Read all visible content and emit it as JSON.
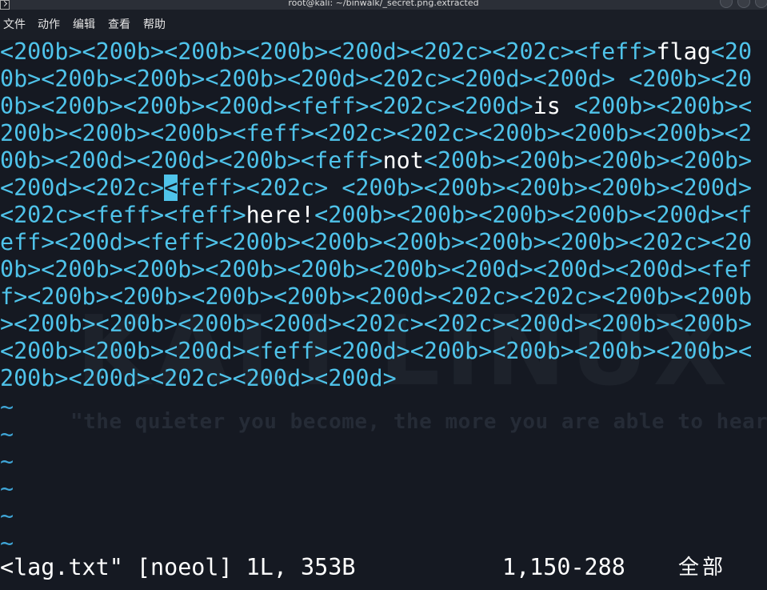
{
  "window": {
    "title": "root@kali: ~/binwalk/_secret.png.extracted"
  },
  "menu": {
    "items": [
      "文件",
      "动作",
      "编辑",
      "查看",
      "帮助"
    ]
  },
  "background": {
    "quote": "\"the quieter you become, the more you are able to hear\"",
    "logo_text": "KALI LINUX"
  },
  "editor": {
    "lines": [
      [
        [
          "tag",
          "<200b><200b><200b><200b><200d><202c><202c><feff>"
        ],
        [
          "text",
          "flag"
        ],
        [
          "tag",
          "<20"
        ]
      ],
      [
        [
          "tag",
          "0b><200b><200b><200b><200d><202c><200d><200d> <200b><20"
        ]
      ],
      [
        [
          "tag",
          "0b><200b><200b><200d><feff><202c><200d>"
        ],
        [
          "text",
          "is "
        ],
        [
          "tag",
          "<200b><200b><"
        ]
      ],
      [
        [
          "tag",
          "200b><200b><200b><feff><202c><202c><200b><200b><200b><2"
        ]
      ],
      [
        [
          "tag",
          "00b><200d><200d><200b><feff>"
        ],
        [
          "text",
          "not"
        ],
        [
          "tag",
          "<200b><200b><200b><200b>"
        ]
      ],
      [
        [
          "tag",
          "<200d><202c>"
        ],
        [
          "cursor",
          "<"
        ],
        [
          "tag",
          "feff><202c> <200b><200b><200b><200b><200d>"
        ]
      ],
      [
        [
          "tag",
          "<202c><feff><feff>"
        ],
        [
          "text",
          "here!"
        ],
        [
          "tag",
          "<200b><200b><200b><200b><200d><f"
        ]
      ],
      [
        [
          "tag",
          "eff><200d><feff><200b><200b><200b><200b><200b><202c><20"
        ]
      ],
      [
        [
          "tag",
          "0b><200b><200b><200b><200b><200b><200d><200d><200d><fef"
        ]
      ],
      [
        [
          "tag",
          "f><200b><200b><200b><200b><200d><202c><202c><200b><200b"
        ]
      ],
      [
        [
          "tag",
          "><200b><200b><200b><200d><202c><202c><200d><200b><200b>"
        ]
      ],
      [
        [
          "tag",
          "<200b><200b><200d><feff><200d><200b><200b><200b><200b><"
        ]
      ],
      [
        [
          "tag",
          "200b><200d><202c><200d><200d>"
        ]
      ]
    ],
    "tilde": "~",
    "tilde_count": 6
  },
  "status": {
    "file": "<lag.txt\" [noeol] 1L, 353B",
    "position": "1,150-288",
    "percent": "全部"
  },
  "colors": {
    "tag": "#4fc3ea",
    "text": "#ffffff",
    "background": "#151922"
  }
}
